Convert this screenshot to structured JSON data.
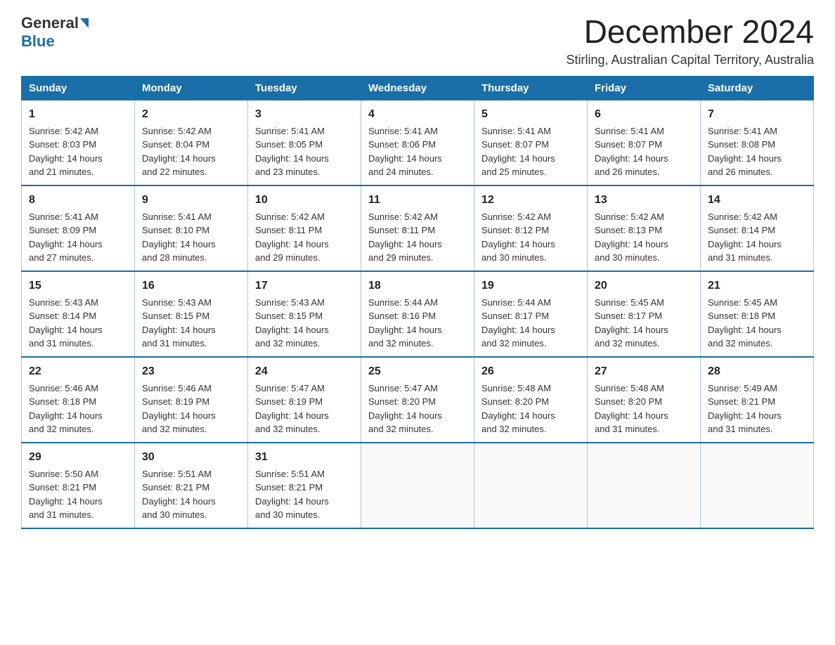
{
  "logo": {
    "general": "General",
    "blue": "Blue"
  },
  "title": "December 2024",
  "subtitle": "Stirling, Australian Capital Territory, Australia",
  "days_of_week": [
    "Sunday",
    "Monday",
    "Tuesday",
    "Wednesday",
    "Thursday",
    "Friday",
    "Saturday"
  ],
  "weeks": [
    [
      {
        "day": "1",
        "sunrise": "5:42 AM",
        "sunset": "8:03 PM",
        "daylight": "14 hours and 21 minutes."
      },
      {
        "day": "2",
        "sunrise": "5:42 AM",
        "sunset": "8:04 PM",
        "daylight": "14 hours and 22 minutes."
      },
      {
        "day": "3",
        "sunrise": "5:41 AM",
        "sunset": "8:05 PM",
        "daylight": "14 hours and 23 minutes."
      },
      {
        "day": "4",
        "sunrise": "5:41 AM",
        "sunset": "8:06 PM",
        "daylight": "14 hours and 24 minutes."
      },
      {
        "day": "5",
        "sunrise": "5:41 AM",
        "sunset": "8:07 PM",
        "daylight": "14 hours and 25 minutes."
      },
      {
        "day": "6",
        "sunrise": "5:41 AM",
        "sunset": "8:07 PM",
        "daylight": "14 hours and 26 minutes."
      },
      {
        "day": "7",
        "sunrise": "5:41 AM",
        "sunset": "8:08 PM",
        "daylight": "14 hours and 26 minutes."
      }
    ],
    [
      {
        "day": "8",
        "sunrise": "5:41 AM",
        "sunset": "8:09 PM",
        "daylight": "14 hours and 27 minutes."
      },
      {
        "day": "9",
        "sunrise": "5:41 AM",
        "sunset": "8:10 PM",
        "daylight": "14 hours and 28 minutes."
      },
      {
        "day": "10",
        "sunrise": "5:42 AM",
        "sunset": "8:11 PM",
        "daylight": "14 hours and 29 minutes."
      },
      {
        "day": "11",
        "sunrise": "5:42 AM",
        "sunset": "8:11 PM",
        "daylight": "14 hours and 29 minutes."
      },
      {
        "day": "12",
        "sunrise": "5:42 AM",
        "sunset": "8:12 PM",
        "daylight": "14 hours and 30 minutes."
      },
      {
        "day": "13",
        "sunrise": "5:42 AM",
        "sunset": "8:13 PM",
        "daylight": "14 hours and 30 minutes."
      },
      {
        "day": "14",
        "sunrise": "5:42 AM",
        "sunset": "8:14 PM",
        "daylight": "14 hours and 31 minutes."
      }
    ],
    [
      {
        "day": "15",
        "sunrise": "5:43 AM",
        "sunset": "8:14 PM",
        "daylight": "14 hours and 31 minutes."
      },
      {
        "day": "16",
        "sunrise": "5:43 AM",
        "sunset": "8:15 PM",
        "daylight": "14 hours and 31 minutes."
      },
      {
        "day": "17",
        "sunrise": "5:43 AM",
        "sunset": "8:15 PM",
        "daylight": "14 hours and 32 minutes."
      },
      {
        "day": "18",
        "sunrise": "5:44 AM",
        "sunset": "8:16 PM",
        "daylight": "14 hours and 32 minutes."
      },
      {
        "day": "19",
        "sunrise": "5:44 AM",
        "sunset": "8:17 PM",
        "daylight": "14 hours and 32 minutes."
      },
      {
        "day": "20",
        "sunrise": "5:45 AM",
        "sunset": "8:17 PM",
        "daylight": "14 hours and 32 minutes."
      },
      {
        "day": "21",
        "sunrise": "5:45 AM",
        "sunset": "8:18 PM",
        "daylight": "14 hours and 32 minutes."
      }
    ],
    [
      {
        "day": "22",
        "sunrise": "5:46 AM",
        "sunset": "8:18 PM",
        "daylight": "14 hours and 32 minutes."
      },
      {
        "day": "23",
        "sunrise": "5:46 AM",
        "sunset": "8:19 PM",
        "daylight": "14 hours and 32 minutes."
      },
      {
        "day": "24",
        "sunrise": "5:47 AM",
        "sunset": "8:19 PM",
        "daylight": "14 hours and 32 minutes."
      },
      {
        "day": "25",
        "sunrise": "5:47 AM",
        "sunset": "8:20 PM",
        "daylight": "14 hours and 32 minutes."
      },
      {
        "day": "26",
        "sunrise": "5:48 AM",
        "sunset": "8:20 PM",
        "daylight": "14 hours and 32 minutes."
      },
      {
        "day": "27",
        "sunrise": "5:48 AM",
        "sunset": "8:20 PM",
        "daylight": "14 hours and 31 minutes."
      },
      {
        "day": "28",
        "sunrise": "5:49 AM",
        "sunset": "8:21 PM",
        "daylight": "14 hours and 31 minutes."
      }
    ],
    [
      {
        "day": "29",
        "sunrise": "5:50 AM",
        "sunset": "8:21 PM",
        "daylight": "14 hours and 31 minutes."
      },
      {
        "day": "30",
        "sunrise": "5:51 AM",
        "sunset": "8:21 PM",
        "daylight": "14 hours and 30 minutes."
      },
      {
        "day": "31",
        "sunrise": "5:51 AM",
        "sunset": "8:21 PM",
        "daylight": "14 hours and 30 minutes."
      },
      null,
      null,
      null,
      null
    ]
  ],
  "labels": {
    "sunrise": "Sunrise:",
    "sunset": "Sunset:",
    "daylight": "Daylight:"
  }
}
